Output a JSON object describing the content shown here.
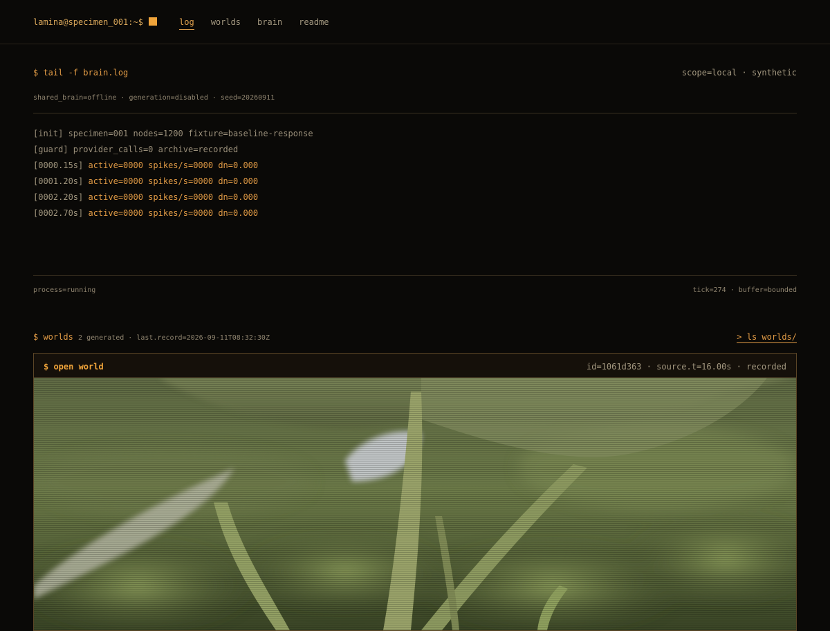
{
  "header": {
    "prompt": "lamina@specimen_001:~$",
    "nav": [
      "log",
      "worlds",
      "brain",
      "readme"
    ],
    "active_nav": "log"
  },
  "log_section": {
    "command": "$ tail -f brain.log",
    "scope": "scope=local · synthetic",
    "status_line": "shared_brain=offline · generation=disabled · seed=20260911",
    "lines": [
      {
        "prefix": "[init]",
        "text": " specimen=001 nodes=1200 fixture=baseline-response"
      },
      {
        "prefix": "[guard]",
        "text": " provider_calls=0 archive=recorded"
      },
      {
        "prefix": "[0000.15s]",
        "text": " active=0000 spikes/s=0000 dn=0.000"
      },
      {
        "prefix": "[0001.20s]",
        "text": " active=0000 spikes/s=0000 dn=0.000"
      },
      {
        "prefix": "[0002.20s]",
        "text": " active=0000 spikes/s=0000 dn=0.000"
      },
      {
        "prefix": "[0002.70s]",
        "text": " active=0000 spikes/s=0000 dn=0.000"
      }
    ],
    "process": "process=running",
    "tick": "tick=274 · buffer=bounded"
  },
  "worlds_section": {
    "label": "$ worlds",
    "meta": "2 generated · last.record=2026-09-11T08:32:30Z",
    "link": "> ls worlds/",
    "panel": {
      "title": "$ open world",
      "meta": "id=1061d363 · source.t=16.00s · recorded"
    }
  },
  "colors": {
    "accent": "#e09a45",
    "background": "#0a0907",
    "cursor": "#f0a43a"
  }
}
